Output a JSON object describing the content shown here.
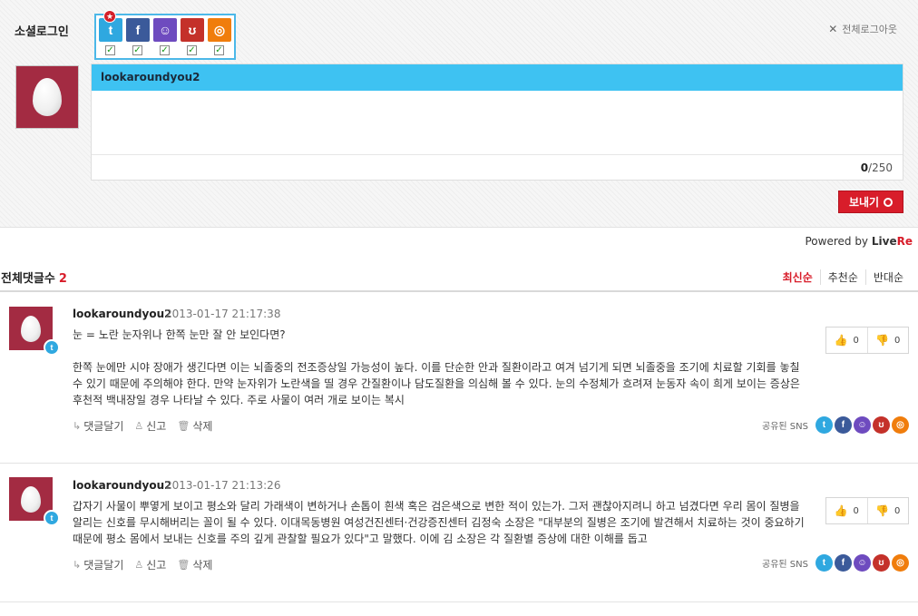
{
  "social_login": {
    "label": "소셜로그인",
    "logout_label": "전체로그아웃",
    "services": [
      {
        "name": "twitter-icon",
        "glyph": "t",
        "color": "#2fa8e0"
      },
      {
        "name": "facebook-icon",
        "glyph": "f",
        "color": "#3b5a9a"
      },
      {
        "name": "me2day-icon",
        "glyph": "☺",
        "color": "#6e4bbf"
      },
      {
        "name": "yozm-icon",
        "glyph": "ʊ",
        "color": "#c4312a"
      },
      {
        "name": "cyworld-icon",
        "glyph": "◎",
        "color": "#f07d0c"
      }
    ],
    "check_glyph": "✓"
  },
  "editor": {
    "username": "lookaroundyou2",
    "char_count": "0",
    "char_limit": "/250"
  },
  "send_label": "보내기",
  "powered_by": {
    "prefix": "Powered by",
    "brand_a": "Live",
    "brand_b": "Re"
  },
  "comments_header": {
    "title": "전체댓글수",
    "count": "2",
    "sorts": [
      "최신순",
      "추천순",
      "반대순"
    ]
  },
  "comments": [
    {
      "author": "lookaroundyou2",
      "date": "2013-01-17 21:17:38",
      "text": "눈 = 노란 눈자위나 한쪽 눈만 잘 안 보인다면?\n\n한쪽 눈에만 시야 장애가 생긴다면 이는 뇌졸중의 전조증상일 가능성이 높다. 이를 단순한 안과 질환이라고 여겨 넘기게 되면 뇌졸중을 조기에 치료할 기회를 놓칠 수 있기 때문에 주의해야 한다. 만약 눈자위가 노란색을 띨 경우 간질환이나 담도질환을 의심해 볼 수 있다. 눈의 수정체가 흐려져 눈동자 속이 희게 보이는 증상은 후천적 백내장일 경우 나타날 수 있다. 주로 사물이 여러 개로 보이는 복시",
      "likes": "0",
      "dislikes": "0"
    },
    {
      "author": "lookaroundyou2",
      "date": "2013-01-17 21:13:26",
      "text": "갑자기 사물이 뿌옇게 보이고 평소와 달리 가래색이 변하거나 손톱이 흰색 혹은 검은색으로 변한 적이 있는가. 그저 괜찮아지려니 하고 넘겼다면 우리 몸이 질병을 알리는 신호를 무시해버리는 꼴이 될 수 있다. 이대목동병원 여성건진센터·건강증진센터 김정숙 소장은 \"대부분의 질병은 조기에 발견해서 치료하는 것이 중요하기 때문에 평소 몸에서 보내는 신호를 주의 깊게 관찰할 필요가 있다\"고 말했다. 이에 김 소장은 각 질환별 증상에 대한 이해를 돕고",
      "likes": "0",
      "dislikes": "0"
    }
  ],
  "comment_actions": {
    "reply": "댓글달기",
    "report": "신고",
    "delete": "삭제"
  },
  "shared_sns_label": "공유된 SNS"
}
